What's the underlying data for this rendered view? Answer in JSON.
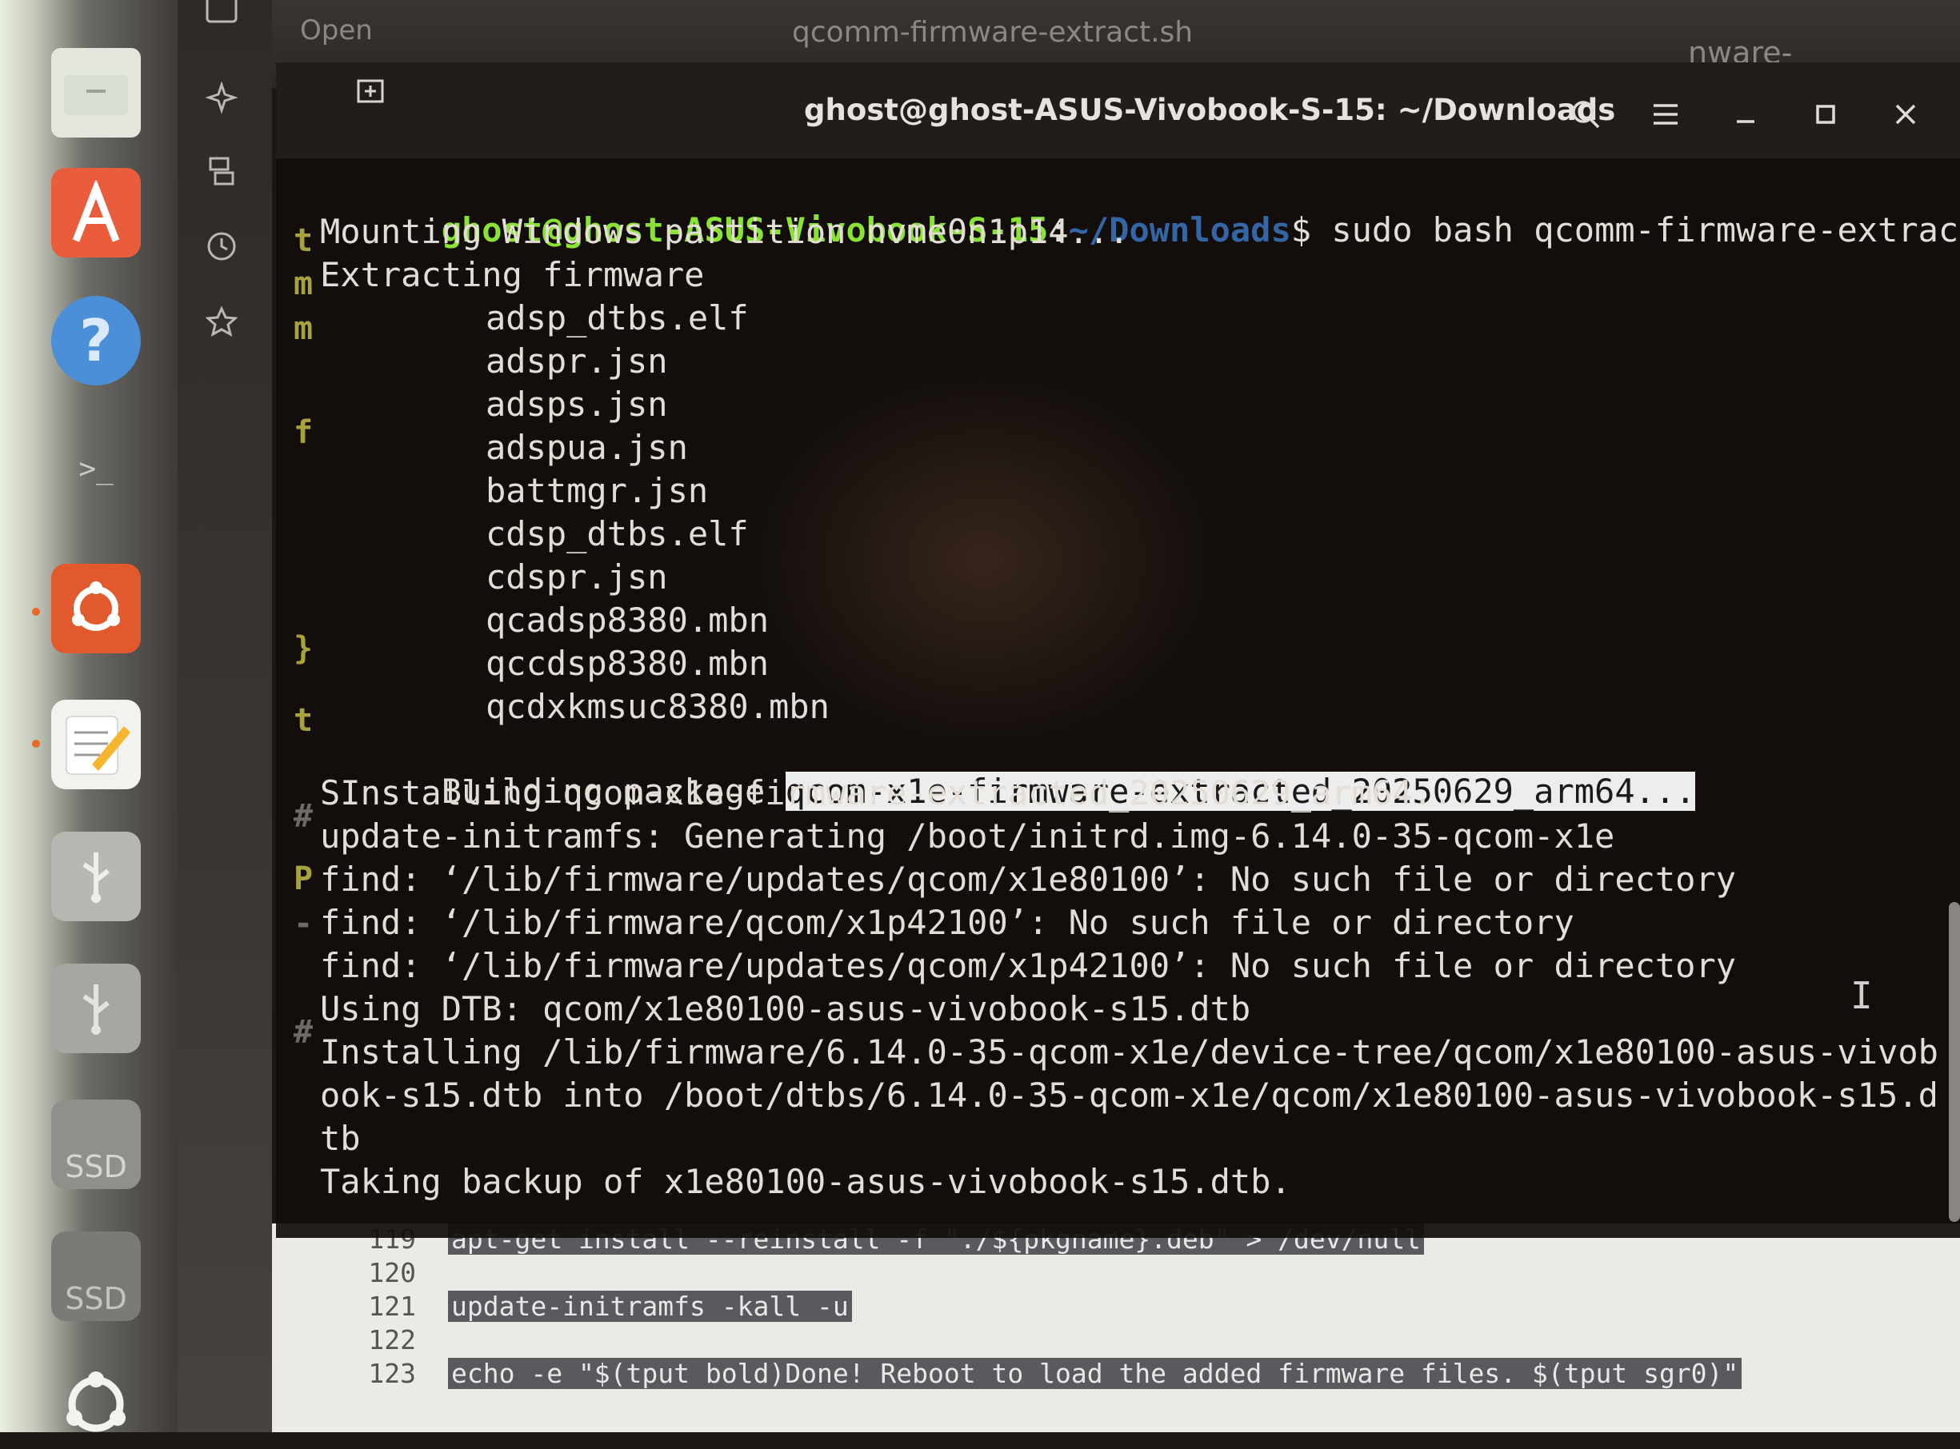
{
  "dock": {
    "items": [
      {
        "name": "Files"
      },
      {
        "name": "App Center"
      },
      {
        "name": "Help"
      },
      {
        "name": "Terminal"
      },
      {
        "name": "Ubuntu"
      },
      {
        "name": "Text Editor"
      },
      {
        "name": "USB drive"
      },
      {
        "name": "USB drive"
      },
      {
        "name": "SSD drive",
        "label": "SSD"
      },
      {
        "name": "SSD drive",
        "label": "SSD"
      },
      {
        "name": "Show Apps"
      }
    ]
  },
  "background_window": {
    "tab_label": "Open",
    "title": "qcomm-firmware-extract.sh",
    "url_fragment": "nware-extract/tree/"
  },
  "terminal": {
    "title": "ghost@ghost-ASUS-Vivobook-S-15: ~/Downloads",
    "prompt_user": "ghost@ghost-ASUS-Vivobook-S-15",
    "prompt_sep": ":",
    "prompt_path": "~/Downloads",
    "prompt_symbol": "$",
    "command": " sudo bash qcomm-firmware-extract.sh",
    "lines": {
      "mounting": "Mounting Windows partition nvme0n1p14...",
      "extracting": "Extracting firmware",
      "building_prefix": "Building package ",
      "building_package": "qcom-x1e-firmware-extracted_20250629_arm64...",
      "installing": "SInstalling qcom-x1e-firmware-extracted_20250629_arm64...",
      "initramfs": "update-initramfs: Generating /boot/initrd.img-6.14.0-35-qcom-x1e",
      "find1": "find: ‘/lib/firmware/updates/qcom/x1e80100’: No such file or directory",
      "find2": "find: ‘/lib/firmware/qcom/x1p42100’: No such file or directory",
      "find3": "find: ‘/lib/firmware/updates/qcom/x1p42100’: No such file or directory",
      "dtb": "Using DTB: qcom/x1e80100-asus-vivobook-s15.dtb",
      "install_dtb_1": "Installing /lib/firmware/6.14.0-35-qcom-x1e/device-tree/qcom/x1e80100-asus-vivob",
      "install_dtb_2": "ook-s15.dtb into /boot/dtbs/6.14.0-35-qcom-x1e/qcom/x1e80100-asus-vivobook-s15.d",
      "install_dtb_3": "tb",
      "backup": "Taking backup of x1e80100-asus-vivobook-s15.dtb."
    },
    "firmware_files": [
      "adsp_dtbs.elf",
      "adspr.jsn",
      "adsps.jsn",
      "adspua.jsn",
      "battmgr.jsn",
      "cdsp_dtbs.elf",
      "cdspr.jsn",
      "qcadsp8380.mbn",
      "qccdsp8380.mbn",
      "qcdxkmsuc8380.mbn"
    ],
    "gutter_chars": [
      "t",
      "m",
      "m",
      "f",
      "}",
      "t",
      "#",
      "P",
      "-",
      "#"
    ]
  },
  "editor": {
    "lines": [
      {
        "num": "119",
        "code": "apt-get install --reinstall -f \"./${pkgname}.deb\" > /dev/null"
      },
      {
        "num": "120",
        "code": ""
      },
      {
        "num": "121",
        "code": "update-initramfs -kall -u"
      },
      {
        "num": "122",
        "code": ""
      },
      {
        "num": "123",
        "code": "echo -e \"$(tput bold)Done! Reboot to load the added firmware files. $(tput sgr0)\""
      }
    ]
  },
  "colors": {
    "prompt_user": "#8ae234",
    "prompt_path": "#3465a4",
    "terminal_bg": "#120e0c",
    "selection_bg": "#ededed",
    "ubuntu_orange": "#e95420"
  }
}
